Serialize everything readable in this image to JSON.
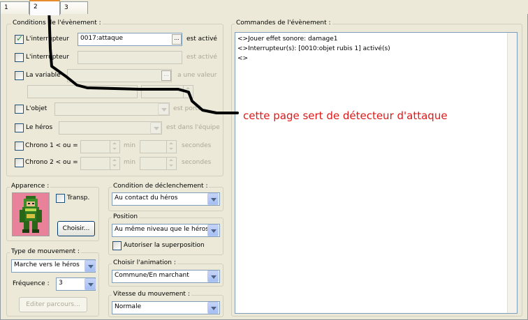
{
  "tabs": [
    {
      "label": "1"
    },
    {
      "label": "2"
    },
    {
      "label": "3"
    }
  ],
  "conditions": {
    "title": "Conditions de l'évènement :",
    "switch1": {
      "label": "L'interrupteur",
      "value": "0017:attaque",
      "suffix": "est activé",
      "checked": true
    },
    "switch2": {
      "label": "L'interrupteur",
      "value": "",
      "suffix": "est activé",
      "checked": false
    },
    "variable": {
      "label": "La variable",
      "suffix": "a une valeur",
      "checked": false
    },
    "object": {
      "label": "L'objet",
      "suffix": "est porté",
      "checked": false
    },
    "hero": {
      "label": "Le héros",
      "suffix": "est dans l'équipe",
      "checked": false
    },
    "timer1": {
      "label": "Chrono 1 < ou = à",
      "min": "min",
      "sec": "secondes",
      "checked": false
    },
    "timer2": {
      "label": "Chrono 2 < ou = à",
      "min": "min",
      "sec": "secondes",
      "checked": false
    },
    "dots": "..."
  },
  "appearance": {
    "title": "Apparence :",
    "transp_label": "Transp.",
    "choose_button": "Choisir..."
  },
  "trigger": {
    "title": "Condition de déclenchement :",
    "value": "Au contact du héros"
  },
  "position": {
    "title": "Position",
    "value": "Au même niveau que le héros",
    "overlap_label": "Autoriser la superposition"
  },
  "movement": {
    "title": "Type de mouvement :",
    "value": "Marche vers le héros",
    "freq_label": "Fréquence :",
    "freq_value": "3",
    "edit_button": "Editer parcours..."
  },
  "animation": {
    "title": "Choisir l'animation :",
    "value": "Commune/En marchant"
  },
  "speed": {
    "title": "Vitesse du mouvement :",
    "value": "Normale"
  },
  "commands": {
    "title": "Commandes de l'évènement :",
    "lines": [
      "<>Jouer effet sonore: damage1",
      "<>Interrupteur(s): [0010:objet rubis 1] activé(s)",
      "<>"
    ]
  },
  "annotation": "cette page sert de détecteur d'attaque",
  "colors": {
    "annotation": "#e01818",
    "tab_accent": "#e68b2c"
  }
}
